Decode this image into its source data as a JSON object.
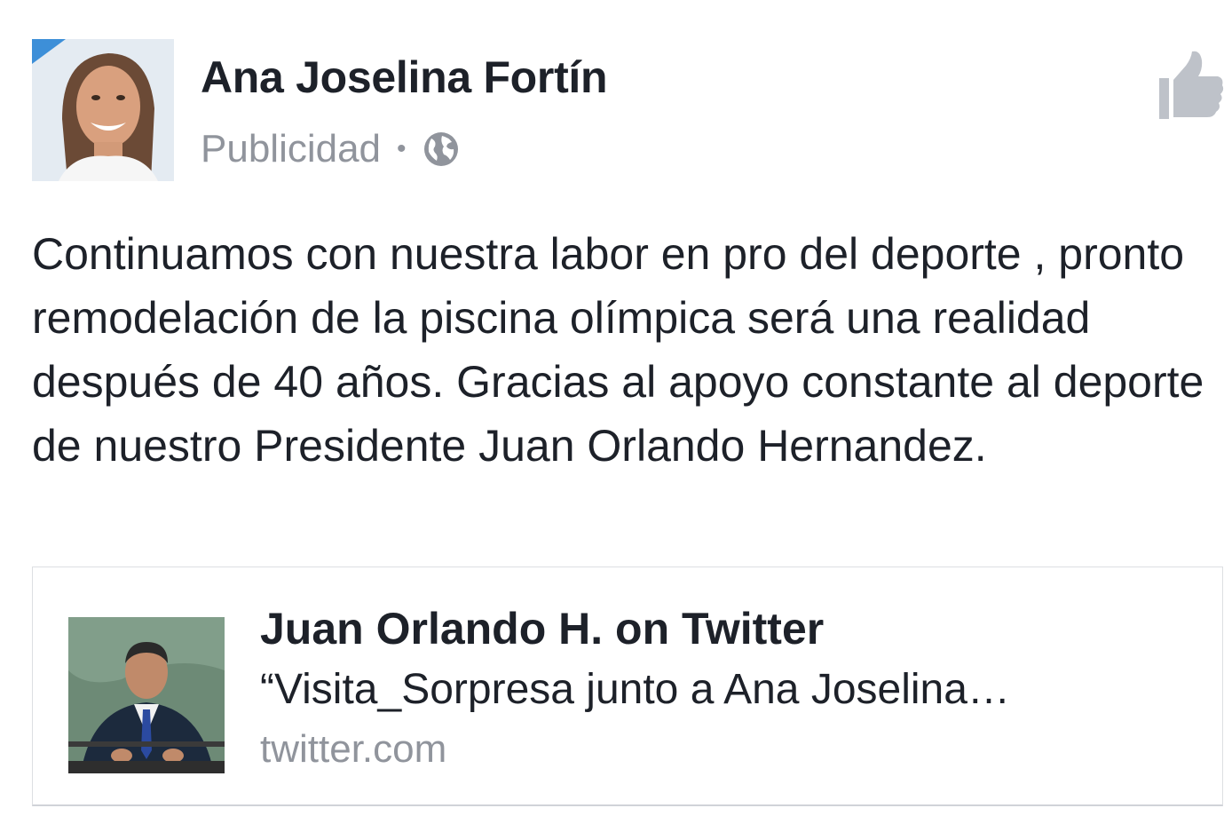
{
  "post": {
    "author_name": "Ana Joselina Fortín",
    "sponsored_label": "Publicidad",
    "separator": "•",
    "audience_icon": "globe-icon",
    "like_icon": "thumbs-up-icon",
    "text": "Continuamos con nuestra labor en pro del deporte , pronto remodelación de la piscina olímpica será una realidad después de 40 años. Gracias al apoyo constante al deporte de nuestro Presidente Juan Orlando Hernandez."
  },
  "link_card": {
    "title": "Juan Orlando H. on Twitter",
    "description": "“Visita_Sorpresa junto a Ana Joselina…",
    "domain": "twitter.com"
  },
  "colors": {
    "primary_text": "#1d2129",
    "secondary_text": "#90949c",
    "icon_gray": "#bec2c9",
    "card_border": "#dddfe2"
  }
}
